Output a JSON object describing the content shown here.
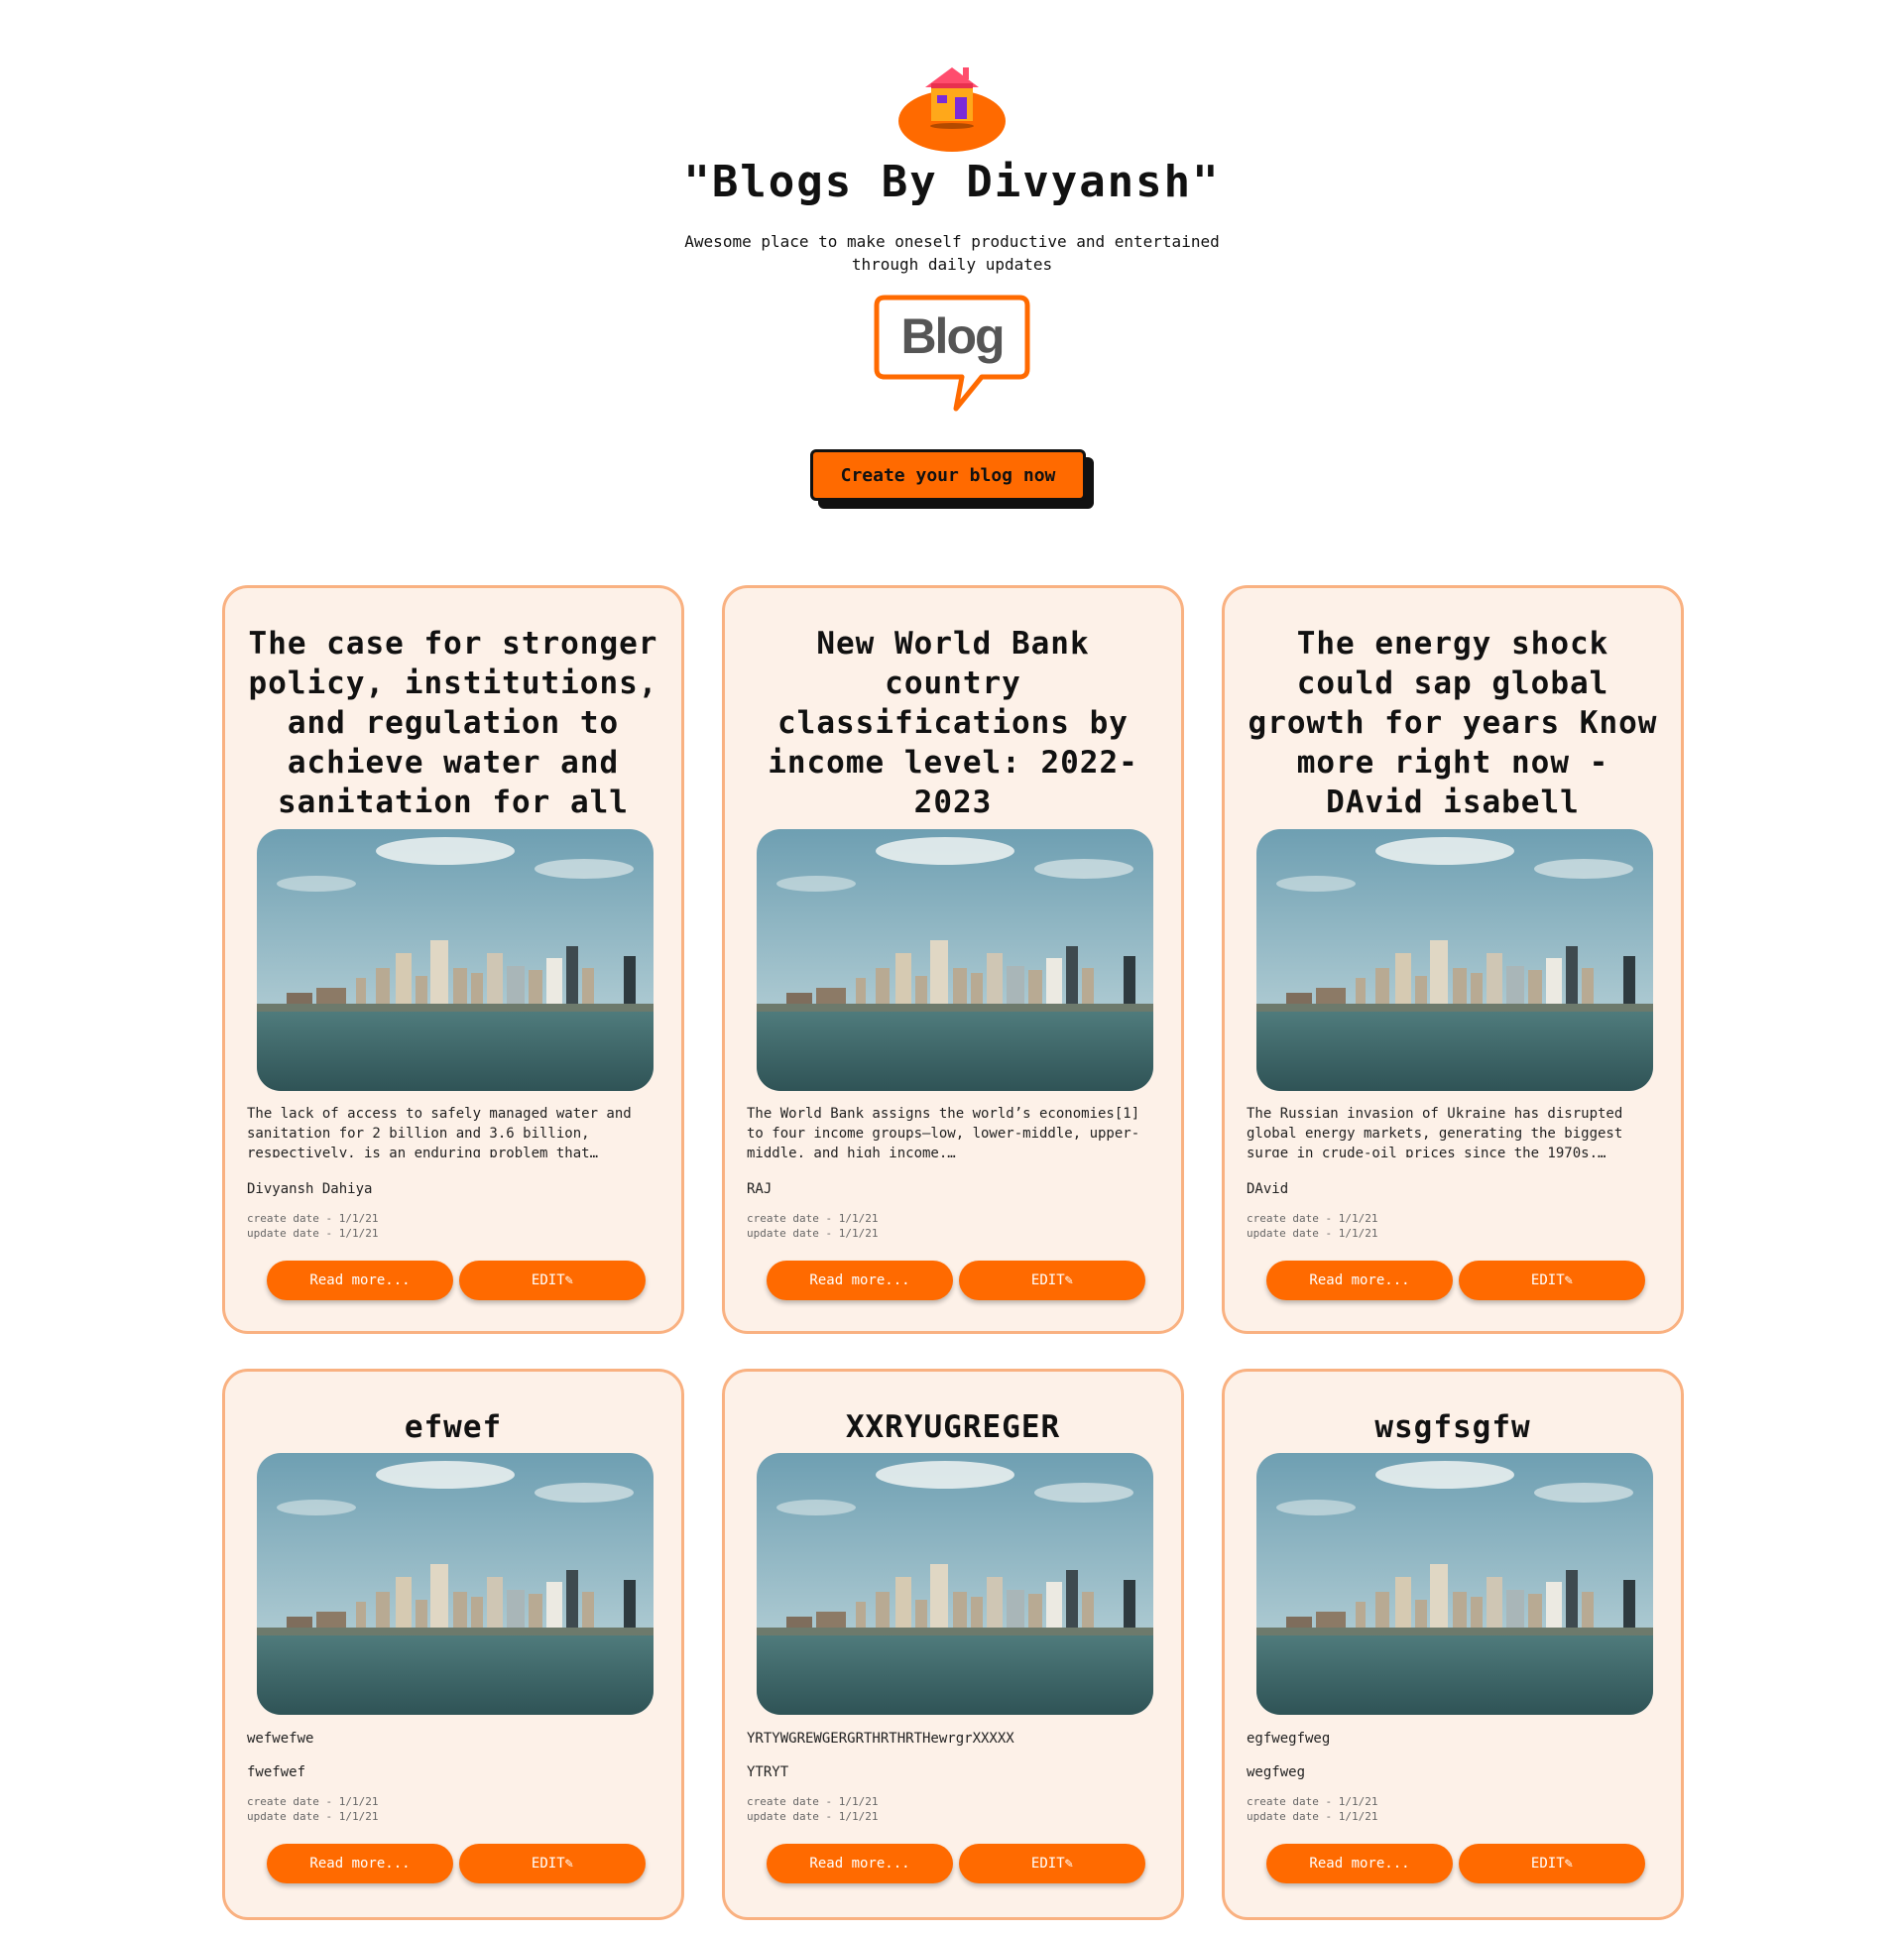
{
  "site": {
    "title": "\"Blogs By Divyansh\"",
    "tagline": "Awesome place to make oneself productive and entertained through daily updates",
    "badge_text": "Blog",
    "cta_label": "Create your blog now"
  },
  "colors": {
    "accent": "#ff6a00",
    "card_bg": "#fdf1e8",
    "card_border": "#f9b181"
  },
  "cards": [
    {
      "title": "The case for stronger policy, institutions, and regulation to achieve water and sanitation for all",
      "description": "The lack of access to safely managed water and sanitation for 2 billion and 3.6 billion, respectively, is an enduring problem that…",
      "author": "Divyansh Dahiya",
      "create_date": "create date - 1/1/21",
      "update_date": "update date - 1/1/21",
      "read_more": "Read more...",
      "edit": "EDIT✎"
    },
    {
      "title": "New World Bank country classifications by income level: 2022-2023",
      "description": "The World Bank assigns the world’s economies[1] to four income groups—low, lower-middle, upper-middle, and high income.…",
      "author": "RAJ",
      "create_date": "create date - 1/1/21",
      "update_date": "update date - 1/1/21",
      "read_more": "Read more...",
      "edit": "EDIT✎"
    },
    {
      "title": "The energy shock could sap global growth for years Know more right now - DAvid isabell",
      "description": "The Russian invasion of Ukraine has disrupted global energy markets, generating the biggest surge in crude-oil prices since the 1970s.…",
      "author": "DAvid",
      "create_date": "create date - 1/1/21",
      "update_date": "update date - 1/1/21",
      "read_more": "Read more...",
      "edit": "EDIT✎"
    },
    {
      "title": "efwef",
      "description": "wefwefwe",
      "author": "fwefwef",
      "create_date": "create date - 1/1/21",
      "update_date": "update date - 1/1/21",
      "read_more": "Read more...",
      "edit": "EDIT✎"
    },
    {
      "title": "XXRYUGREGER",
      "description": "YRTYWGREWGERGRTHRTHRTHewrgrXXXXX",
      "author": "YTRYT",
      "create_date": "create date - 1/1/21",
      "update_date": "update date - 1/1/21",
      "read_more": "Read more...",
      "edit": "EDIT✎"
    },
    {
      "title": "wsgfsgfw",
      "description": "egfwegfweg",
      "author": "wegfweg",
      "create_date": "create date - 1/1/21",
      "update_date": "update date - 1/1/21",
      "read_more": "Read more...",
      "edit": "EDIT✎"
    }
  ]
}
